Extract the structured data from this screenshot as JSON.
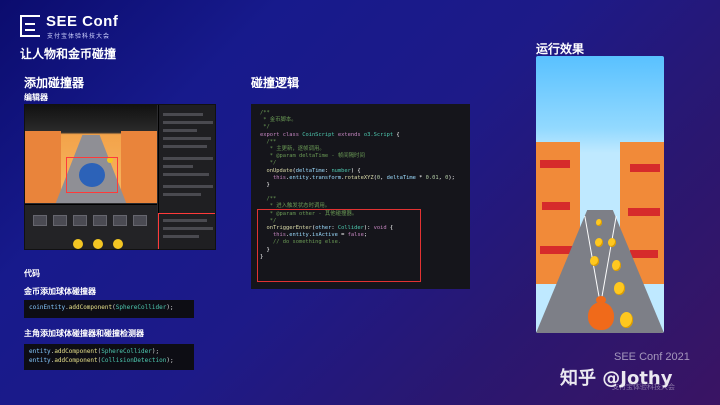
{
  "header": {
    "brand": "SEE Conf",
    "brand_sub": "支付宝体验科技大会",
    "page_title": "让人物和金币碰撞"
  },
  "left": {
    "section_title": "添加碰撞器",
    "editor_label": "编辑器",
    "code_label": "代码",
    "coin_title": "金币添加球体碰撞器",
    "coin_code": {
      "obj": "coinEntity",
      "fn": "addComponent",
      "cls": "SphereCollider"
    },
    "player_title": "主角添加球体碰撞器和碰撞检测器",
    "player_code": [
      {
        "obj": "entity",
        "fn": "addComponent",
        "cls": "SphereCollider"
      },
      {
        "obj": "entity",
        "fn": "addComponent",
        "cls": "CollisionDetection"
      }
    ]
  },
  "middle": {
    "section_title": "碰撞逻辑",
    "code_lines": [
      [
        [
          "cmt",
          "/**"
        ]
      ],
      [
        [
          "cmt",
          " * 金币脚本。"
        ]
      ],
      [
        [
          "cmt",
          " */"
        ]
      ],
      [
        [
          "kw",
          "export class "
        ],
        [
          "ty",
          "CoinScript"
        ],
        [
          "kw",
          " extends "
        ],
        [
          "ty",
          "o3.Script"
        ],
        [
          "plain",
          " {"
        ]
      ],
      [
        [
          "cmt",
          "  /**"
        ]
      ],
      [
        [
          "cmt",
          "   * 主更新，逐帧调用。"
        ]
      ],
      [
        [
          "cmt",
          "   * @param deltaTime - 帧间隔时间"
        ]
      ],
      [
        [
          "cmt",
          "   */"
        ]
      ],
      [
        [
          "fnc",
          "  onUpdate"
        ],
        [
          "plain",
          "("
        ],
        [
          "vr",
          "deltaTime"
        ],
        [
          "plain",
          ": "
        ],
        [
          "ty",
          "number"
        ],
        [
          "plain",
          ") {"
        ]
      ],
      [
        [
          "kw",
          "    this"
        ],
        [
          "plain",
          "."
        ],
        [
          "vr",
          "entity"
        ],
        [
          "plain",
          "."
        ],
        [
          "vr",
          "transform"
        ],
        [
          "plain",
          "."
        ],
        [
          "fnc",
          "rotateXYZ"
        ],
        [
          "plain",
          "("
        ],
        [
          "nm",
          "0"
        ],
        [
          "plain",
          ", "
        ],
        [
          "vr",
          "deltaTime"
        ],
        [
          "plain",
          " * "
        ],
        [
          "nm",
          "0.01"
        ],
        [
          "plain",
          ", "
        ],
        [
          "nm",
          "0"
        ],
        [
          "plain",
          ");"
        ]
      ],
      [
        [
          "plain",
          "  }"
        ]
      ],
      [
        [
          "plain",
          ""
        ]
      ],
      [
        [
          "cmt",
          "  /**"
        ]
      ],
      [
        [
          "cmt",
          "   * 进入触发状态时调用。"
        ]
      ],
      [
        [
          "cmt",
          "   * @param other - 其他碰撞器。"
        ]
      ],
      [
        [
          "cmt",
          "   */"
        ]
      ],
      [
        [
          "fnc",
          "  onTriggerEnter"
        ],
        [
          "plain",
          "("
        ],
        [
          "vr",
          "other"
        ],
        [
          "plain",
          ": "
        ],
        [
          "ty",
          "Collider"
        ],
        [
          "plain",
          "): "
        ],
        [
          "kw",
          "void"
        ],
        [
          "plain",
          " {"
        ]
      ],
      [
        [
          "kw",
          "    this"
        ],
        [
          "plain",
          "."
        ],
        [
          "vr",
          "entity"
        ],
        [
          "plain",
          "."
        ],
        [
          "vr",
          "isActive"
        ],
        [
          "plain",
          " = "
        ],
        [
          "kw",
          "false"
        ],
        [
          "plain",
          ";"
        ]
      ],
      [
        [
          "cmt",
          "    // do something else."
        ]
      ],
      [
        [
          "plain",
          "  }"
        ]
      ],
      [
        [
          "plain",
          "}"
        ]
      ]
    ]
  },
  "right": {
    "section_title": "运行效果"
  },
  "watermark": {
    "zhihu": "知乎 @Jothy",
    "conf": "SEE Conf 2021",
    "sub": "支付宝体验科技大会"
  },
  "colors": {
    "accent_red": "#e23232",
    "coin_yellow": "#ffc81f",
    "bg_navy": "#171a8c"
  }
}
